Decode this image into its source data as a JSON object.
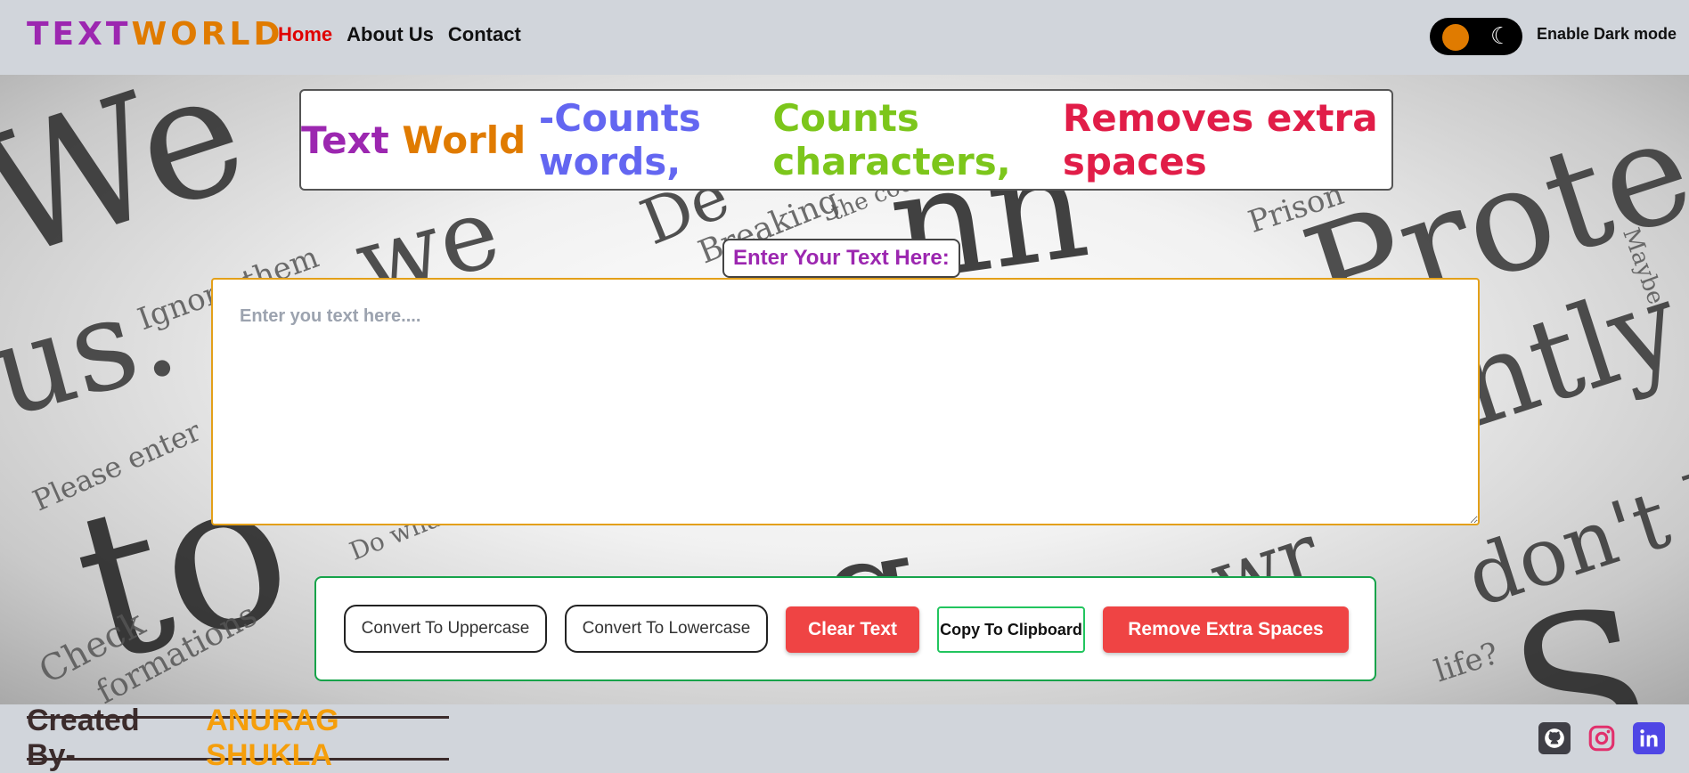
{
  "navbar": {
    "brand_part1": "TEXT",
    "brand_part2": "WORLD",
    "links": [
      "Home",
      "About Us",
      "Contact"
    ],
    "dark_mode_label": "Enable Dark mode"
  },
  "hero": {
    "title_parts": [
      "Text",
      "World",
      "-Counts words,",
      "Counts characters,",
      "Removes extra spaces"
    ],
    "input_label": "Enter Your Text Here:",
    "textarea_placeholder": "Enter you text here....",
    "textarea_value": ""
  },
  "actions": {
    "uppercase": "Convert To Uppercase",
    "lowercase": "Convert To Lowercase",
    "clear": "Clear Text",
    "copy": "Copy To Clipboard",
    "remove_spaces": "Remove Extra Spaces"
  },
  "footer": {
    "created_by": "Created By-",
    "author": "ANURAG SHUKLA"
  },
  "background_words": [
    "We",
    "us.",
    "to",
    "we",
    "Ignore them",
    "Please enter",
    "Check",
    "formations",
    "Do wha",
    "Breaking",
    "De",
    "the code",
    "Prison",
    "ently",
    "Protec",
    "Maybe",
    "don't kno",
    "life?",
    "wr",
    "ag",
    "S",
    "nn"
  ],
  "colors": {
    "brand_purple": "#9c27b0",
    "brand_orange": "#e07b00",
    "title_blue": "#6366f1",
    "title_green": "#7cc61b",
    "title_red": "#e11d48",
    "button_red": "#ef4444",
    "navbar_bg": "#d1d5db",
    "author_orange": "#f59e0b"
  },
  "icons": [
    "moon-icon",
    "github-icon",
    "instagram-icon",
    "linkedin-icon"
  ]
}
